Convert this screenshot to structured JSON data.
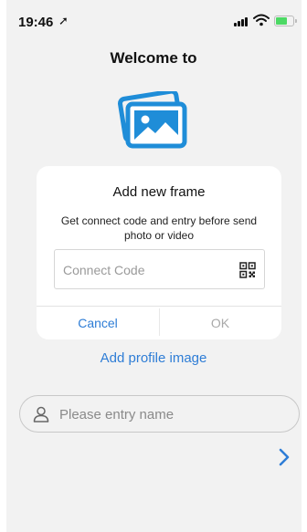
{
  "status_bar": {
    "time": "19:46",
    "location_arrow": "➚"
  },
  "page": {
    "title": "Welcome to",
    "add_profile_image_label": "Add profile image",
    "name_placeholder": "Please entry name",
    "icons": [
      "photos-icon",
      "person-icon",
      "chevron-right-icon"
    ]
  },
  "dialog": {
    "title": "Add new frame",
    "message": "Get connect code and entry before send photo or video",
    "code_placeholder": "Connect Code",
    "cancel_label": "Cancel",
    "ok_label": "OK",
    "icons": [
      "qr-code-icon"
    ]
  },
  "colors": {
    "accent": "#2e7dd6",
    "disabled": "#a9a9a9",
    "battery": "#4cd964"
  }
}
